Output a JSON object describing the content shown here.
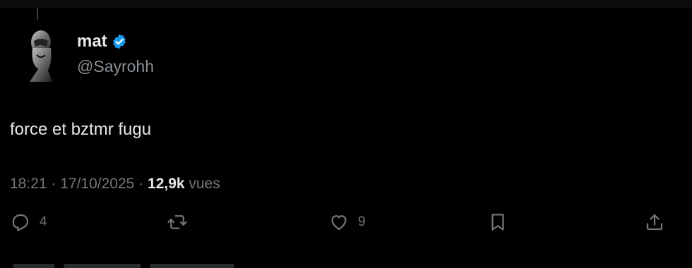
{
  "author": {
    "display_name": "mat",
    "handle": "@Sayrohh",
    "verified_icon": "verified-badge-icon",
    "verified_color": "#1d9bf0"
  },
  "post": {
    "text": "force et bztmr fugu"
  },
  "meta": {
    "time": "18:21",
    "separator": " · ",
    "date": "17/10/2025",
    "views_count": "12,9k",
    "views_label": "vues"
  },
  "actions": {
    "reply_count": "4",
    "repost_count": "",
    "like_count": "9"
  },
  "colors": {
    "background": "#000000",
    "text": "#e7e9ea",
    "muted": "#71767b"
  }
}
